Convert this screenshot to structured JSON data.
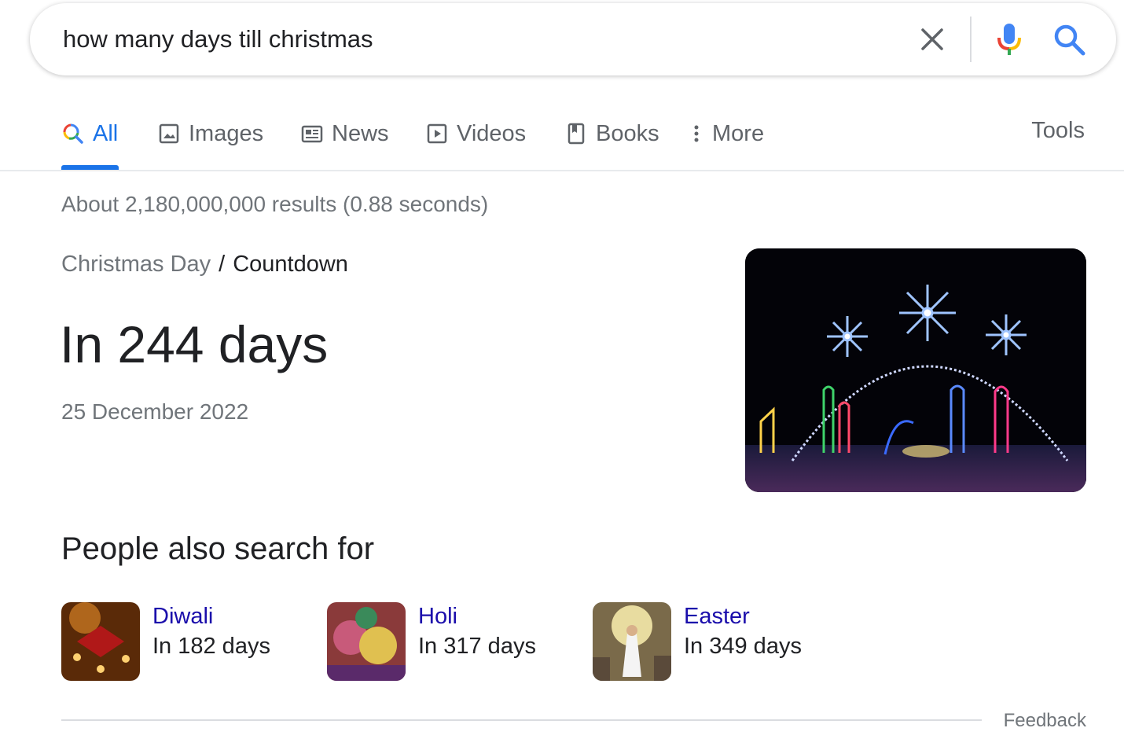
{
  "search": {
    "query": "how many days till christmas",
    "clear_icon": "close-icon",
    "mic_icon": "microphone-icon",
    "search_icon": "search-icon"
  },
  "tabs": [
    {
      "label": "All",
      "icon": "search-icon",
      "active": true
    },
    {
      "label": "Images",
      "icon": "image-icon",
      "active": false
    },
    {
      "label": "News",
      "icon": "news-icon",
      "active": false
    },
    {
      "label": "Videos",
      "icon": "play-icon",
      "active": false
    },
    {
      "label": "Books",
      "icon": "book-icon",
      "active": false
    },
    {
      "label": "More",
      "icon": "more-vert-icon",
      "active": false
    }
  ],
  "tools_label": "Tools",
  "result_stats": "About 2,180,000,000 results (0.88 seconds)",
  "answer": {
    "breadcrumb_parent": "Christmas Day",
    "breadcrumb_sep": "/",
    "breadcrumb_current": "Countdown",
    "headline": "In 244 days",
    "date": "25 December 2022"
  },
  "people_also_search": {
    "title": "People also search for",
    "items": [
      {
        "name": "Diwali",
        "sub": "In 182 days"
      },
      {
        "name": "Holi",
        "sub": "In 317 days"
      },
      {
        "name": "Easter",
        "sub": "In 349 days"
      }
    ]
  },
  "feedback_label": "Feedback",
  "colors": {
    "accent": "#1a73e8",
    "link": "#1a0dab",
    "muted": "#70757a",
    "text": "#202124"
  }
}
